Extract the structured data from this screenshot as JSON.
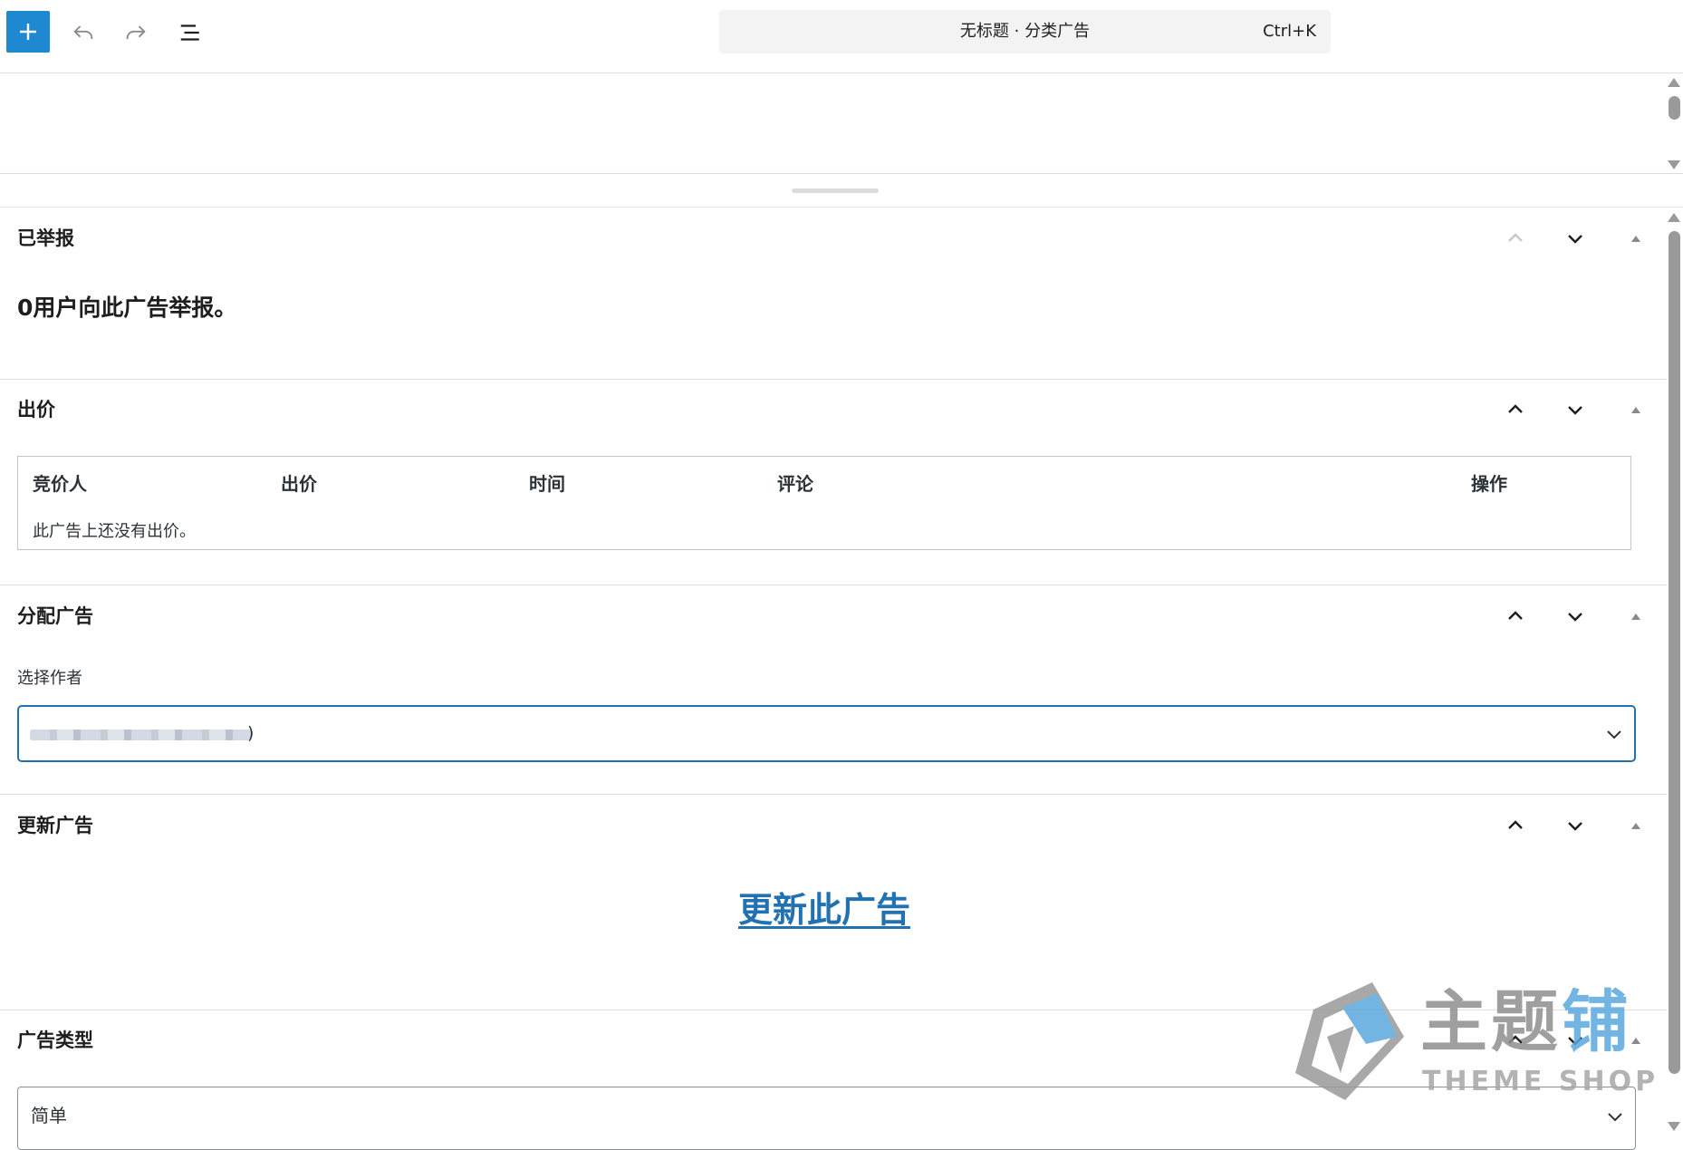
{
  "toolbar": {
    "add_icon": "plus-icon",
    "undo_icon": "undo-icon",
    "redo_icon": "redo-icon",
    "outline_icon": "list-view-icon",
    "command_title": "无标题 · 分类广告",
    "command_shortcut": "Ctrl+K"
  },
  "metaboxes": {
    "reported": {
      "title": "已举报",
      "text": "0用户向此广告举报。"
    },
    "bids": {
      "title": "出价",
      "columns": [
        "竞价人",
        "出价",
        "时间",
        "评论",
        "操作"
      ],
      "empty_text": "此广告上还没有出价。"
    },
    "assign": {
      "title": "分配广告",
      "label": "选择作者",
      "selected_suffix": ")"
    },
    "update": {
      "title": "更新广告",
      "link_text": "更新此广告"
    },
    "ad_type": {
      "title": "广告类型",
      "selected": "简单"
    }
  },
  "watermark": {
    "text_cn_a": "主题",
    "text_cn_b": "铺",
    "text_en": "THEME SHOP"
  },
  "colors": {
    "accent": "#2271b1",
    "add_button": "#1e88d1"
  }
}
